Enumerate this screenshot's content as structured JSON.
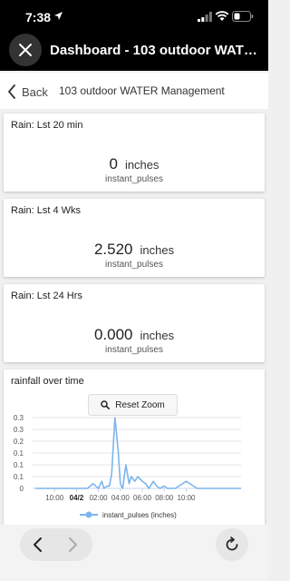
{
  "status": {
    "time": "7:38"
  },
  "topbar": {
    "title": "Dashboard - 103 outdoor WATER Management"
  },
  "nav": {
    "back_label": "Back",
    "title": "103 outdoor WATER Management"
  },
  "cards": [
    {
      "title": "Rain: Lst 20 min",
      "value": "0",
      "unit": "inches",
      "sub": "instant_pulses"
    },
    {
      "title": "Rain: Lst 4 Wks",
      "value": "2.520",
      "unit": "inches",
      "sub": "instant_pulses"
    },
    {
      "title": "Rain: Lst 24 Hrs",
      "value": "0.000",
      "unit": "inches",
      "sub": "instant_pulses"
    }
  ],
  "chart": {
    "title": "rainfall over time",
    "reset_zoom_label": "Reset Zoom"
  },
  "chart_data": {
    "type": "line",
    "title": "",
    "xlabel": "",
    "ylabel": "",
    "y_tick_labels": [
      "0.3",
      "0.3",
      "0.2",
      "0.1",
      "0.1",
      "0.1",
      "0"
    ],
    "x_tick_labels": [
      "10:00",
      "04/2",
      "02:00",
      "04:00",
      "06:00",
      "08:00",
      "10:00"
    ],
    "x_hours": [
      8.25,
      9,
      10,
      11,
      12,
      13,
      13.5,
      14,
      14.3,
      14.5,
      14.8,
      15,
      15.2,
      15.5,
      15.8,
      16,
      16.2,
      16.5,
      16.8,
      17,
      17.3,
      17.6,
      18,
      18.3,
      18.6,
      19,
      19.3,
      19.6,
      20,
      20.3,
      21,
      22,
      23,
      24,
      25,
      26,
      27
    ],
    "series": [
      {
        "name": "instant_pulses (inches)",
        "color": "#7cb5ec",
        "values": [
          0,
          0,
          0,
          0,
          0,
          0,
          0.02,
          0,
          0.03,
          0,
          0.01,
          0.01,
          0.06,
          0.3,
          0.16,
          0.02,
          0,
          0.1,
          0.02,
          0.05,
          0.03,
          0.05,
          0.03,
          0.02,
          0,
          0.03,
          0.01,
          0,
          0.01,
          0,
          0,
          0.03,
          0,
          0,
          0,
          0,
          0
        ]
      }
    ],
    "ylim": [
      0,
      0.3
    ],
    "grid": true,
    "legend": "bottom-center"
  },
  "colors": {
    "accent": "#7cb5ec",
    "topbar": "#000000"
  }
}
